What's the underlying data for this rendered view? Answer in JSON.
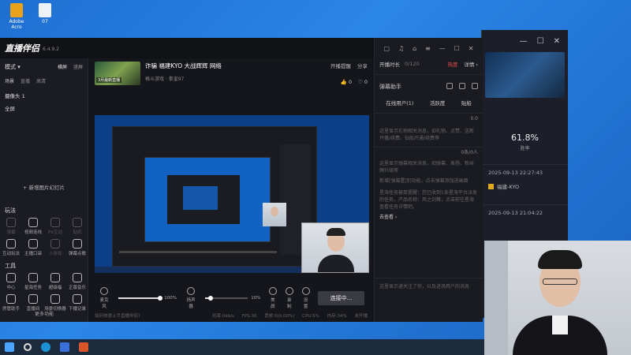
{
  "desktop": {
    "icons": [
      {
        "label": "Adobe Acro"
      },
      {
        "label": "07"
      }
    ]
  },
  "background_window": {
    "stat_value": "61.8%",
    "stat_label": "胜率",
    "row1_time": "2025-09-13 22:27:43",
    "row2_text": "福建-KYO",
    "row3_time": "2025-09-13 21:04:22"
  },
  "app": {
    "logo": "直播伴侣",
    "version": "6.4.9.2",
    "sidebar": {
      "mode_label": "模式 ▾",
      "orientation_landscape": "横屏",
      "orientation_portrait": "竖屏",
      "source_tabs": [
        "场景",
        "直播",
        "高清"
      ],
      "sources": [
        "摄像头 1",
        "全屏"
      ],
      "add_source": "+ 新增图片幻灯片",
      "section_play": "玩法",
      "play_items": [
        {
          "label": "弹幕"
        },
        {
          "label": "视频连线"
        },
        {
          "label": "PK互动"
        },
        {
          "label": "贴纸"
        },
        {
          "label": "互动玩法"
        },
        {
          "label": "主播口袋"
        },
        {
          "label": "小游戏"
        },
        {
          "label": "弹幕点歌"
        }
      ],
      "section_tools": "工具",
      "tool_items": [
        {
          "label": "中心"
        },
        {
          "label": "星海任务"
        },
        {
          "label": "超级福"
        },
        {
          "label": "正版音乐"
        },
        {
          "label": "房管助手"
        },
        {
          "label": "直播间"
        },
        {
          "label": "场景切换器"
        },
        {
          "label": "下播记录"
        }
      ],
      "more": "更多功能"
    },
    "room": {
      "thumb_caption": "3月最新直播",
      "title": "诈骗 福建KYO 大战辉辉 网络",
      "category": "格斗游戏 · 拳皇97",
      "open_reminder": "开播提醒",
      "share": "分享",
      "likes": "0",
      "hearts": "0"
    },
    "controls": {
      "mic_label": "麦克风",
      "mic_volume": "100%",
      "speaker_label": "扬声器",
      "speaker_volume": "10%",
      "beauty": "美颜",
      "record": "录制",
      "settings": "设置",
      "live_button": "连接中..."
    },
    "status": {
      "help": "如何快速上手直播伴侣?",
      "bitrate": "码率:0kb/s",
      "fps": "FPS:30",
      "drop": "丢帧:0(0.00%)",
      "cpu": "CPU:5%",
      "mem": "内存:34%",
      "net": "未开播"
    },
    "right_panel": {
      "live_duration_label": "开播时长",
      "live_duration_value": "0/120",
      "hot": "热度",
      "details": "详情 ›",
      "assistant_title": "弹幕助手",
      "tabs": [
        "在线用户(1)",
        "活跃度",
        "贴船"
      ],
      "gift_msg": "这里显示礼物相关消息，如礼物、点赞、送新开播/续费、钻船开通/续费等",
      "gift_count": "0.0",
      "danmu_msg": "这里显示弹幕相关消息，如弹幕、表扬、粉丝牌升级等",
      "danmu_count": "0条/0人",
      "notice1": "新增[弹幕置顶]功能，点击弹幕添加进画面",
      "notice2": "星海任务被单提醒：您已收到1条星海平台派发的任务，产品名称：风之剑舞，点击前往星海查看任务详情吧。",
      "notice_link": "去查看 ›",
      "bottom_msg": "这里显示递关注了你，以及进场用户的消息"
    }
  }
}
